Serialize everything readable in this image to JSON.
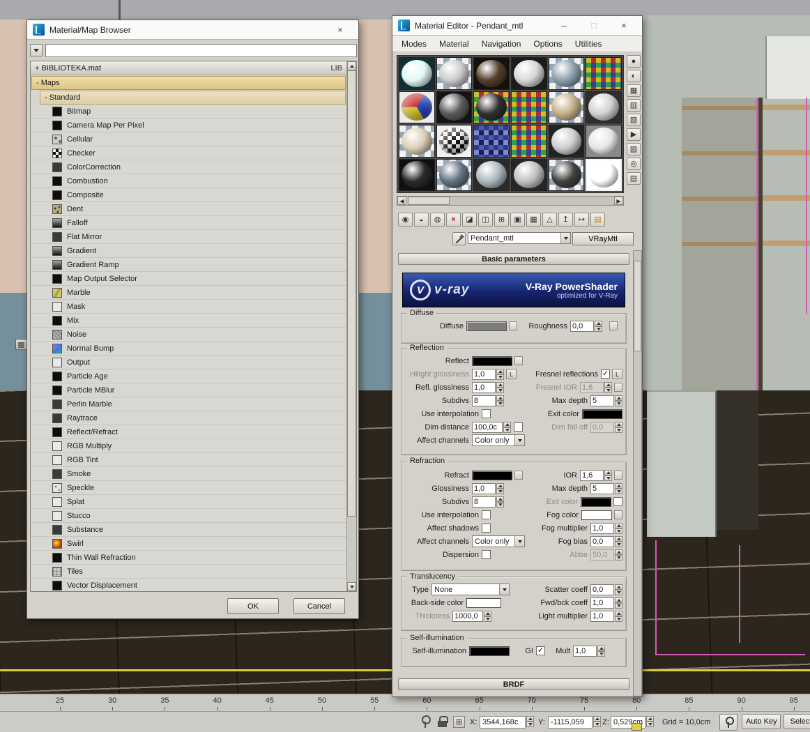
{
  "glyphs": {
    "minimize": "–",
    "maximize": "□",
    "close": "×",
    "check": "✓"
  },
  "colors": {
    "maps_header": "#e8d49c",
    "vray_banner_top": "#3a5bb4",
    "vray_banner_bottom": "#0b1340",
    "selection_magenta": "#d45cb4",
    "active_viewport_border": "#d8cf3a"
  },
  "browser": {
    "title": "Material/Map Browser",
    "search": {
      "value": ""
    },
    "library": {
      "label": "+ BIBLIOTEKA.mat",
      "tag": "LIB"
    },
    "maps_header": "- Maps",
    "standard_header": "- Standard",
    "entries": [
      {
        "label": "Bitmap",
        "icon": "black"
      },
      {
        "label": "Camera Map Per Pixel",
        "icon": "black"
      },
      {
        "label": "Cellular",
        "icon": "dots"
      },
      {
        "label": "Checker",
        "icon": "checker"
      },
      {
        "label": "ColorCorrection",
        "icon": "dark"
      },
      {
        "label": "Combustion",
        "icon": "black"
      },
      {
        "label": "Composite",
        "icon": "black"
      },
      {
        "label": "Dent",
        "icon": "speckle"
      },
      {
        "label": "Falloff",
        "icon": "grad"
      },
      {
        "label": "Flat Mirror",
        "icon": "dark"
      },
      {
        "label": "Gradient",
        "icon": "grad"
      },
      {
        "label": "Gradient Ramp",
        "icon": "grad"
      },
      {
        "label": "Map Output Selector",
        "icon": "black"
      },
      {
        "label": "Marble",
        "icon": "marble"
      },
      {
        "label": "Mask",
        "icon": "light"
      },
      {
        "label": "Mix",
        "icon": "black"
      },
      {
        "label": "Noise",
        "icon": "noise"
      },
      {
        "label": "Normal Bump",
        "icon": "normal"
      },
      {
        "label": "Output",
        "icon": "light"
      },
      {
        "label": "Particle Age",
        "icon": "black"
      },
      {
        "label": "Particle MBlur",
        "icon": "black"
      },
      {
        "label": "Perlin Marble",
        "icon": "dark"
      },
      {
        "label": "Raytrace",
        "icon": "dark"
      },
      {
        "label": "Reflect/Refract",
        "icon": "black"
      },
      {
        "label": "RGB Multiply",
        "icon": "light"
      },
      {
        "label": "RGB Tint",
        "icon": "light"
      },
      {
        "label": "Smoke",
        "icon": "dark"
      },
      {
        "label": "Speckle",
        "icon": "specklelight"
      },
      {
        "label": "Splat",
        "icon": "light"
      },
      {
        "label": "Stucco",
        "icon": "light"
      },
      {
        "label": "Substance",
        "icon": "dark"
      },
      {
        "label": "Swirl",
        "icon": "swirl"
      },
      {
        "label": "Thin Wall Refraction",
        "icon": "black"
      },
      {
        "label": "Tiles",
        "icon": "grid"
      },
      {
        "label": "Vector Displacement",
        "icon": "black"
      }
    ],
    "ok": "OK",
    "cancel": "Cancel"
  },
  "editor": {
    "title": "Material Editor - Pendant_mtl",
    "menus": [
      "Modes",
      "Material",
      "Navigation",
      "Options",
      "Utilities"
    ],
    "slots": [
      {
        "bg": "#123034",
        "ball": "#e2f8f4"
      },
      {
        "bg": "checker",
        "ball": "#cccccc"
      },
      {
        "bg": "#15100c",
        "ball": "#53402c"
      },
      {
        "bg": "#1c1c1c",
        "ball": "#d8d8d8"
      },
      {
        "bg": "checker",
        "ball": "#8ba0ac"
      },
      {
        "bg": "colorcheck",
        "ball": null
      },
      {
        "bg": "#ececec",
        "ball": "wheel"
      },
      {
        "bg": "#141414",
        "ball": "#5c5c5c"
      },
      {
        "bg": "colorcheck",
        "ball": "#303030"
      },
      {
        "bg": "colorcheck",
        "ball": null
      },
      {
        "bg": "checker",
        "ball": "#c7b08a"
      },
      {
        "bg": "#2e2e2e",
        "ball": "#d2d2d2"
      },
      {
        "bg": "checker",
        "ball": "#dccfb6"
      },
      {
        "bg": "#f0f0f0",
        "ball": "checkerball"
      },
      {
        "bg": "bluecheck",
        "ball": null
      },
      {
        "bg": "colorcheck",
        "ball": null
      },
      {
        "bg": "#222222",
        "ball": "#cfcfcf"
      },
      {
        "bg": "#8a8a8a",
        "ball": "#e6e6e6"
      },
      {
        "bg": "#101010",
        "ball": "#2a2a2a"
      },
      {
        "bg": "checker",
        "ball": "#647382"
      },
      {
        "bg": "#2a2a2a",
        "ball": "#aeb9c0"
      },
      {
        "bg": "#262626",
        "ball": "#c2c2c2"
      },
      {
        "bg": "checker",
        "ball": "#424242"
      },
      {
        "bg": "#ffffff",
        "ball": "#ffffff",
        "selected": true
      }
    ],
    "side_tools": [
      {
        "name": "sample-type-icon",
        "glyph": "●"
      },
      {
        "name": "backlight-icon",
        "glyph": "◐"
      },
      {
        "name": "background-icon",
        "glyph": "▦"
      },
      {
        "name": "sample-uv-tiling-icon",
        "glyph": "▥"
      },
      {
        "name": "video-color-check-icon",
        "glyph": "▧"
      },
      {
        "name": "make-preview-icon",
        "glyph": "▶"
      },
      {
        "name": "options-icon",
        "glyph": "▨"
      },
      {
        "name": "select-by-material-icon",
        "glyph": "◎"
      },
      {
        "name": "material-map-navigator-side-icon",
        "glyph": "▤"
      }
    ],
    "toolbar": [
      {
        "name": "get-material-icon",
        "glyph": "◉"
      },
      {
        "name": "put-material-to-scene-icon",
        "glyph": "◒"
      },
      {
        "name": "assign-material-to-selection-icon",
        "glyph": "◍"
      },
      {
        "name": "reset-map-mtl-icon",
        "glyph": "×"
      },
      {
        "name": "make-material-copy-icon",
        "glyph": "◪"
      },
      {
        "name": "make-unique-icon",
        "glyph": "◫"
      },
      {
        "name": "put-to-library-icon",
        "glyph": "⊞"
      },
      {
        "name": "material-id-channel-icon",
        "glyph": "▣"
      },
      {
        "name": "show-map-in-viewport-icon",
        "glyph": "▦"
      },
      {
        "name": "show-end-result-icon",
        "glyph": "△"
      },
      {
        "name": "go-to-parent-icon",
        "glyph": "↥"
      },
      {
        "name": "go-forward-to-sibling-icon",
        "glyph": "↦"
      },
      {
        "name": "material-map-navigator-icon",
        "glyph": "▤"
      }
    ],
    "name_field": "Pendant_mtl",
    "type_button": "VRayMtl",
    "rollout_basic": "Basic parameters",
    "rollout_brdf": "BRDF",
    "banner": {
      "logo_v": "V",
      "logo_text": "v-ray",
      "title": "V-Ray PowerShader",
      "subtitle": "optimized for V-Ray"
    },
    "swatches": {
      "diffuse": "#7d7d7d",
      "reflect": "#000000",
      "refl_exit": "#000000",
      "refract": "#000000",
      "refr_exit": "#000000",
      "fog": "#ffffff",
      "backside": "#ffffff",
      "selfillum": "#000000"
    },
    "diffuse": {
      "legend": "Diffuse",
      "diffuse_label": "Diffuse",
      "roughness_label": "Roughness",
      "roughness_value": "0,0"
    },
    "reflection": {
      "legend": "Reflection",
      "reflect_label": "Reflect",
      "hilight_label": "Hilight glossiness",
      "hilight_value": "1,0",
      "lock1": "L",
      "lock2": "L",
      "fresnel_label": "Fresnel reflections",
      "refl_gloss_label": "Refl. glossiness",
      "refl_gloss_value": "1,0",
      "fresnel_ior_label": "Fresnel IOR",
      "fresnel_ior_value": "1,6",
      "subdivs_label": "Subdivs",
      "subdivs_value": "8",
      "max_depth_label": "Max depth",
      "max_depth_value": "5",
      "use_interp_label": "Use interpolation",
      "exit_color_label": "Exit color",
      "dim_distance_label": "Dim distance",
      "dim_distance_value": "100,0c",
      "dim_fall_label": "Dim fall off",
      "dim_fall_value": "0,0",
      "affect_label": "Affect channels",
      "affect_value": "Color only"
    },
    "refraction": {
      "legend": "Refraction",
      "refract_label": "Refract",
      "ior_label": "IOR",
      "ior_value": "1,6",
      "gloss_label": "Glossiness",
      "gloss_value": "1,0",
      "max_depth_label": "Max depth",
      "max_depth_value": "5",
      "subdivs_label": "Subdivs",
      "subdivs_value": "8",
      "exit_color_label": "Exit color",
      "use_interp_label": "Use interpolation",
      "fog_color_label": "Fog color",
      "affect_shadows_label": "Affect shadows",
      "fog_mult_label": "Fog multiplier",
      "fog_mult_value": "1,0",
      "affect_label": "Affect channels",
      "affect_value": "Color only",
      "fog_bias_label": "Fog bias",
      "fog_bias_value": "0,0",
      "dispersion_label": "Dispersion",
      "abbe_label": "Abbe",
      "abbe_value": "50,0"
    },
    "translucency": {
      "legend": "Translucency",
      "type_label": "Type",
      "type_value": "None",
      "scatter_label": "Scatter coeff",
      "scatter_value": "0,0",
      "backside_label": "Back-side color",
      "fwd_label": "Fwd/bck coeff",
      "fwd_value": "1,0",
      "thickness_label": "Thickness",
      "thickness_value": "1000,0",
      "light_mult_label": "Light multiplier",
      "light_mult_value": "1,0"
    },
    "selfillum": {
      "legend": "Self-illumination",
      "label": "Self-illumination",
      "gi_label": "GI",
      "mult_label": "Mult",
      "mult_value": "1,0"
    }
  },
  "statusbar": {
    "x_label": "X:",
    "x_value": "3544,168c",
    "y_label": "Y:",
    "y_value": "-1115,059",
    "z_label": "Z:",
    "z_value": "0,529cm",
    "grid_label": "Grid = 10,0cm",
    "auto_key": "Auto Key",
    "selected": "Selecte"
  },
  "timeline": {
    "ticks": [
      "25",
      "30",
      "35",
      "40",
      "45",
      "50",
      "55",
      "60",
      "65",
      "70",
      "75",
      "80",
      "85",
      "90",
      "95"
    ]
  }
}
